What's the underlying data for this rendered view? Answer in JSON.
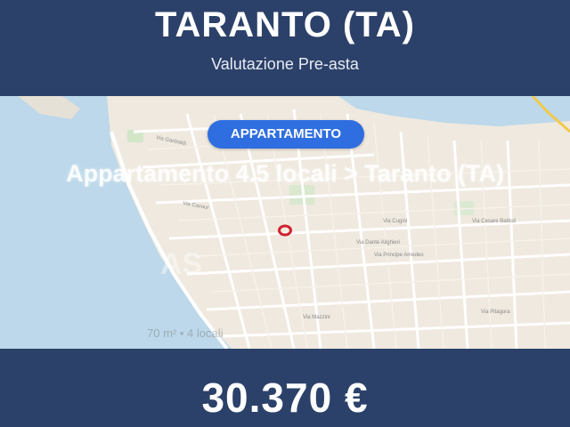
{
  "header": {
    "title": "TARANTO (TA)",
    "subtitle": "Valutazione Pre-asta"
  },
  "listing": {
    "badge": "APPARTAMENTO",
    "title": "Appartamento 4.5 locali > Taranto (TA)",
    "details": "70 m²  •  4 locali"
  },
  "map": {
    "marker_icon": "location-ring-icon",
    "watermark": "AS"
  },
  "footer": {
    "price": "30.370 €"
  },
  "colors": {
    "header_bg": "#2c4169",
    "badge_bg": "#2f6ee0",
    "marker": "#d0222e",
    "water": "#bcd8ea",
    "land": "#efe9df"
  }
}
